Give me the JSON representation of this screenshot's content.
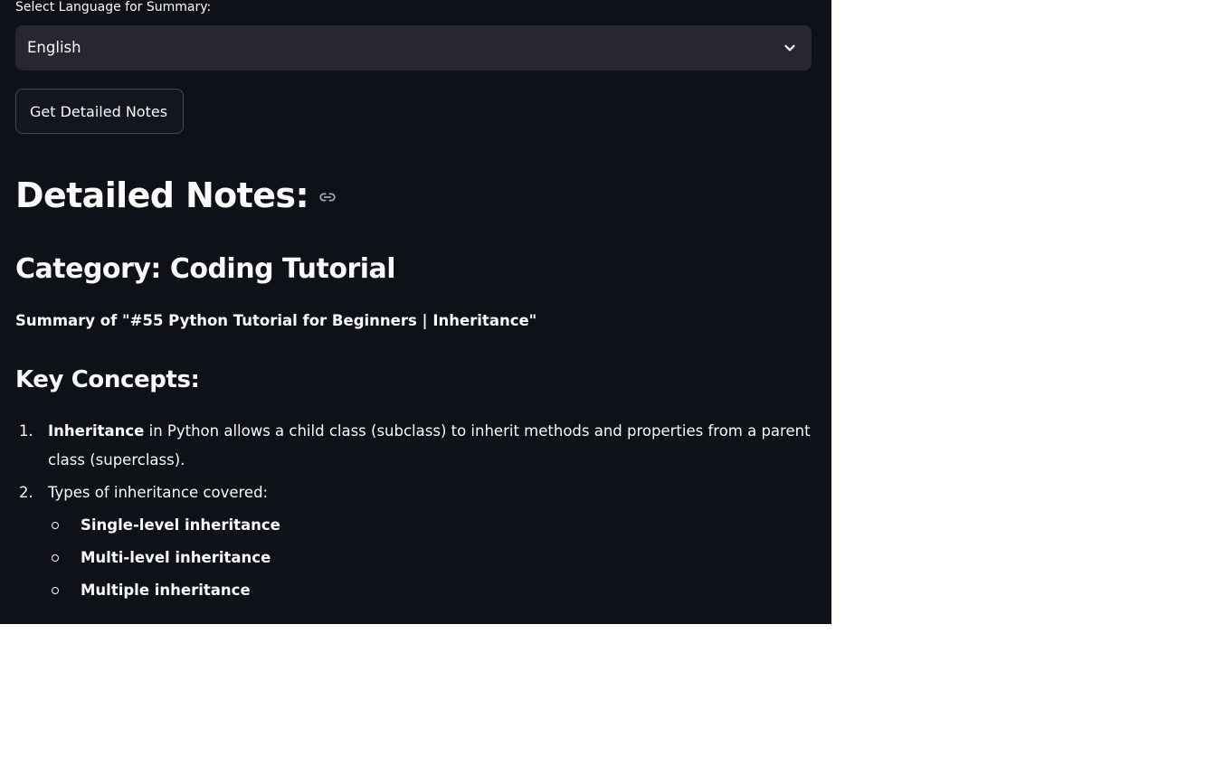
{
  "language_select": {
    "label": "Select Language for Summary:",
    "selected_value": "English",
    "icon": "chevron-down-icon"
  },
  "actions": {
    "get_notes_label": "Get Detailed Notes"
  },
  "notes": {
    "heading": "Detailed Notes:",
    "anchor_icon": "link-icon",
    "category": "Category: Coding Tutorial",
    "summary_title": "Summary of \"#55 Python Tutorial for Beginners | Inheritance\"",
    "key_concepts_heading": "Key Concepts:",
    "items": [
      {
        "number": "1.",
        "bold": "Inheritance",
        "text": " in Python allows a child class (subclass) to inherit methods and properties from a parent class (superclass)."
      },
      {
        "number": "2.",
        "text": "Types of inheritance covered:",
        "subitems": [
          "Single-level inheritance",
          "Multi-level inheritance",
          "Multiple inheritance"
        ]
      }
    ]
  },
  "colors": {
    "background": "#0e1117",
    "surface": "#262730",
    "text": "#fafafa",
    "page_outside": "#ffffff"
  }
}
